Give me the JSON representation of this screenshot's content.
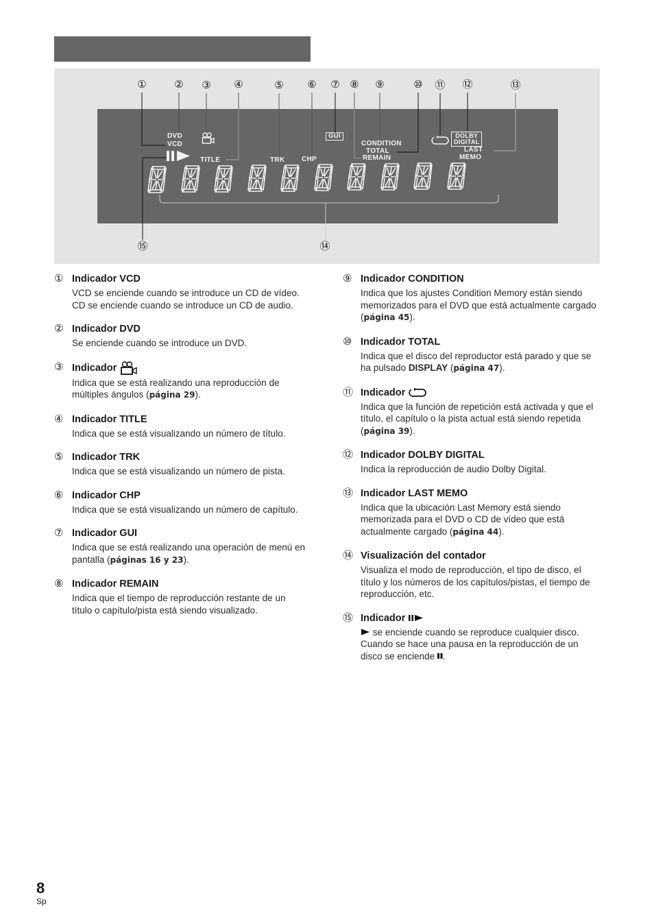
{
  "figure": {
    "callouts": [
      "①",
      "②",
      "③",
      "④",
      "⑤",
      "⑥",
      "⑦",
      "⑧",
      "⑨",
      "⑩",
      "⑪",
      "⑫",
      "⑬",
      "⑭",
      "⑮"
    ],
    "lcd": {
      "dvd": "DVD",
      "vcd": "VCD",
      "title": "TITLE",
      "trk": "TRK",
      "chp": "CHP",
      "gui": "GUI",
      "condition": "CONDITION",
      "total": "TOTAL",
      "remain": "REMAIN",
      "dolby_line1": "DOLBY",
      "dolby_line2": "DIGITAL",
      "last": "LAST",
      "memo": "MEMO",
      "digit_count": 10
    }
  },
  "items": [
    {
      "num": "①",
      "title": "Indicador VCD",
      "desc": "VCD se enciende cuando se introduce un CD de vídeo. CD se enciende cuando se introduce un CD de audio."
    },
    {
      "num": "②",
      "title": "Indicador DVD",
      "desc": "Se enciende cuando se introduce un DVD."
    },
    {
      "num": "③",
      "title": "Indicador",
      "icon": "multi-angle-camera-icon",
      "desc": "Indica que se está realizando una reproducción de múltiples ángulos (",
      "ref": "página 29",
      "tail": ")."
    },
    {
      "num": "④",
      "title": "Indicador TITLE",
      "desc": "Indica que se está visualizando un número de título."
    },
    {
      "num": "⑤",
      "title": "Indicador TRK",
      "desc": "Indica que se está visualizando un número de pista."
    },
    {
      "num": "⑥",
      "title": "Indicador CHP",
      "desc": "Indica que se está visualizando un número de capítulo."
    },
    {
      "num": "⑦",
      "title": "Indicador GUI",
      "desc": "Indica que se está realizando una operación de menú en pantalla (",
      "ref": "páginas 16 y 23",
      "tail": ")."
    },
    {
      "num": "⑧",
      "title": "Indicador REMAIN",
      "desc": "Indica que el tiempo de reproducción restante de un título o capítulo/pista está siendo visualizado."
    },
    {
      "num": "⑨",
      "title": "Indicador CONDITION",
      "desc": "Indica que los ajustes Condition Memory están siendo memorizados para el DVD que está actualmente cargado (",
      "ref": "página 45",
      "tail": ")."
    },
    {
      "num": "⑩",
      "title": "Indicador TOTAL",
      "desc": "Indica que el disco del reproductor está parado y que se ha pulsado ",
      "strong": "DISPLAY",
      "desc2": " (",
      "ref": "página 47",
      "tail": ")."
    },
    {
      "num": "⑪",
      "title": "Indicador",
      "icon": "repeat-icon",
      "desc": "Indica que la función de repetición está activada y que el título, el capítulo o la pista actual está siendo repetida (",
      "ref": "página 39",
      "tail": ")."
    },
    {
      "num": "⑫",
      "title": "Indicador DOLBY DIGITAL",
      "desc": "Indica la reproducción de audio Dolby Digital."
    },
    {
      "num": "⑬",
      "title": "Indicador LAST MEMO",
      "desc": "Indica que la ubicación Last Memory está siendo memorizada para el DVD o CD de vídeo que está actualmente cargado (",
      "ref": "página 44",
      "tail": ")."
    },
    {
      "num": "⑭",
      "title": "Visualización del contador",
      "desc": "Visualiza el modo de reproducción, el tipo de disco, el título y los números de los capítulos/pistas, el tiempo de reproducción, etc."
    },
    {
      "num": "⑮",
      "title": "Indicador",
      "icon": "pause-play-icon",
      "desc_pre_icon": "play-icon",
      "desc": " se enciende cuando se reproduce cualquier disco. Cuando se hace una pausa en la reproducción de un disco se enciende ",
      "tail_icon": "pause-icon",
      "tail": "."
    }
  ],
  "footer": {
    "page_number": "8",
    "language": "Sp"
  }
}
